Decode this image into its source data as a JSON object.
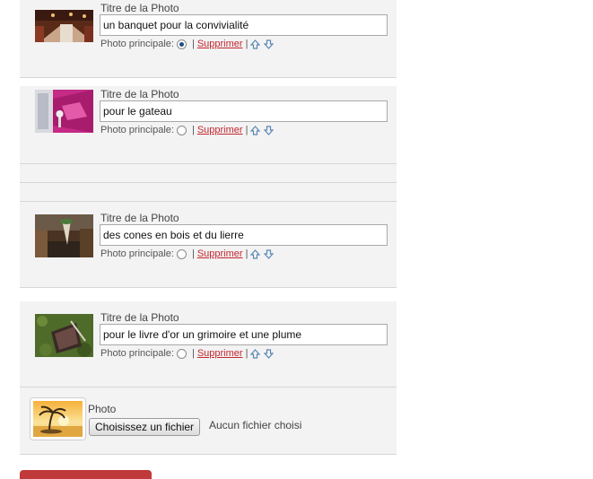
{
  "photos": [
    {
      "title_label": "Titre de la Photo",
      "title_value": "un banquet pour la convivialité",
      "principal_label": "Photo principale:",
      "principal_checked": true,
      "delete_label": "Supprimer",
      "pipe": "|"
    },
    {
      "title_label": "Titre de la Photo",
      "title_value": "pour le gateau",
      "principal_label": "Photo principale:",
      "principal_checked": false,
      "delete_label": "Supprimer",
      "pipe": "|"
    },
    {
      "title_label": "Titre de la Photo",
      "title_value": "des cones en bois et du lierre",
      "principal_label": "Photo principale:",
      "principal_checked": false,
      "delete_label": "Supprimer",
      "pipe": "|"
    },
    {
      "title_label": "Titre de la Photo",
      "title_value": "pour le livre d'or un grimoire et une plume",
      "principal_label": "Photo principale:",
      "principal_checked": false,
      "delete_label": "Supprimer",
      "pipe": "|"
    }
  ],
  "upload": {
    "label": "Photo",
    "button_label": "Choisissez un fichier",
    "status": "Aucun fichier choisi"
  },
  "colors": {
    "panel_bg": "#f3f3f3",
    "link_red": "#c4262e",
    "arrow_blue": "#5b87b5",
    "submit_red": "#c0393b"
  }
}
